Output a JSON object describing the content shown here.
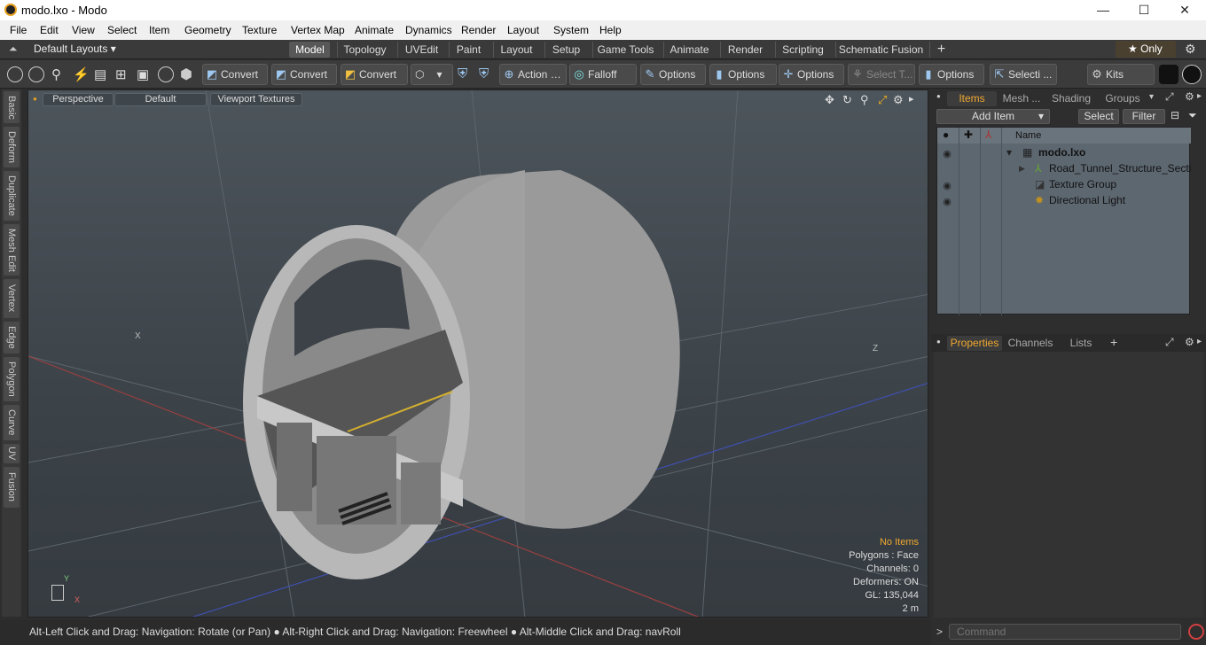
{
  "window": {
    "title": "modo.lxo - Modo",
    "min": "—",
    "max": "☐",
    "close": "✕"
  },
  "menu": [
    "File",
    "Edit",
    "View",
    "Select",
    "Item",
    "Geometry",
    "Texture",
    "Vertex Map",
    "Animate",
    "Dynamics",
    "Render",
    "Layout",
    "System",
    "Help"
  ],
  "layouts_label": "Default Layouts ▾",
  "tabs": [
    "Model",
    "Topology",
    "UVEdit",
    "Paint",
    "Layout",
    "Setup",
    "Game Tools",
    "Animate",
    "Render",
    "Scripting",
    "Schematic Fusion"
  ],
  "tab_add": "+",
  "only_label": "★  Only",
  "toolbar": {
    "convert1": "Convert",
    "convert2": "Convert",
    "convert3": "Convert",
    "action": "Action",
    "falloff": "Falloff",
    "options1": "Options",
    "options2": "Options",
    "options3": "Options",
    "select_t": "Select T...",
    "options4": "Options",
    "selecti": "Selecti ...",
    "kits": "Kits"
  },
  "left_tabs": [
    "Basic",
    "Deform",
    "Duplicate",
    "Mesh Edit",
    "Vertex",
    "Edge",
    "Polygon",
    "Curve",
    "UV",
    "Fusion"
  ],
  "viewport": {
    "perspective": "Perspective",
    "default": "Default",
    "textures": "Viewport Textures",
    "axis_x": "X",
    "axis_z": "Z",
    "axis_y": "Y",
    "gizmo_x": "X"
  },
  "stats": {
    "no_items": "No Items",
    "polygons": "Polygons : Face",
    "channels": "Channels: 0",
    "deformers": "Deformers: ON",
    "gl": "GL: 135,044",
    "scale": "2 m"
  },
  "status": "Alt-Left Click and Drag: Navigation: Rotate (or Pan) ● Alt-Right Click and Drag: Navigation: Freewheel ● Alt-Middle Click and Drag: navRoll",
  "right": {
    "tabs": [
      "Items",
      "Mesh ...",
      "Shading",
      "Groups"
    ],
    "add_item": "Add Item",
    "select": "Select",
    "filter": "Filter",
    "col_name": "Name",
    "items": [
      {
        "name": "modo.lxo"
      },
      {
        "name": "Road_Tunnel_Structure_Secti ..."
      },
      {
        "name": "Texture Group"
      },
      {
        "name": "Directional Light"
      }
    ],
    "prop_tabs": [
      "Properties",
      "Channels",
      "Lists"
    ],
    "command_placeholder": "Command"
  }
}
